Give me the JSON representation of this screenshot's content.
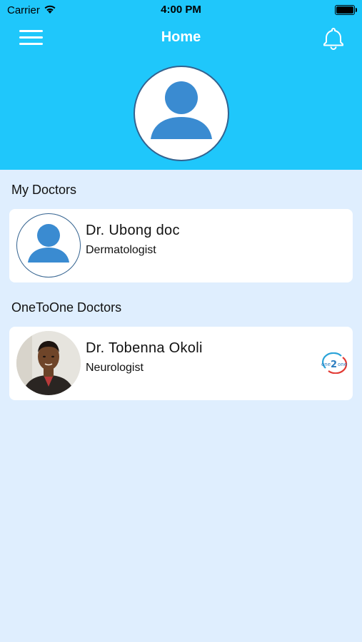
{
  "status_bar": {
    "carrier": "Carrier",
    "time": "4:00 PM"
  },
  "header": {
    "title": "Home",
    "menu_icon": "hamburger-menu-icon",
    "notification_icon": "bell-icon"
  },
  "profile": {
    "avatar_icon": "user-placeholder-icon"
  },
  "sections": {
    "my_doctors": {
      "label": "My Doctors",
      "items": [
        {
          "name": "Dr. Ubong doc",
          "specialty": "Dermatologist",
          "avatar": "user-placeholder-icon"
        }
      ]
    },
    "onetoone_doctors": {
      "label": "OneToOne Doctors",
      "items": [
        {
          "name": "Dr. Tobenna Okoli",
          "specialty": "Neurologist",
          "avatar": "doctor-photo",
          "badge": "one2one-logo"
        }
      ]
    }
  },
  "colors": {
    "header": "#1fc7fb",
    "background": "#dfeefe",
    "avatar_blue": "#3a8bd1"
  }
}
